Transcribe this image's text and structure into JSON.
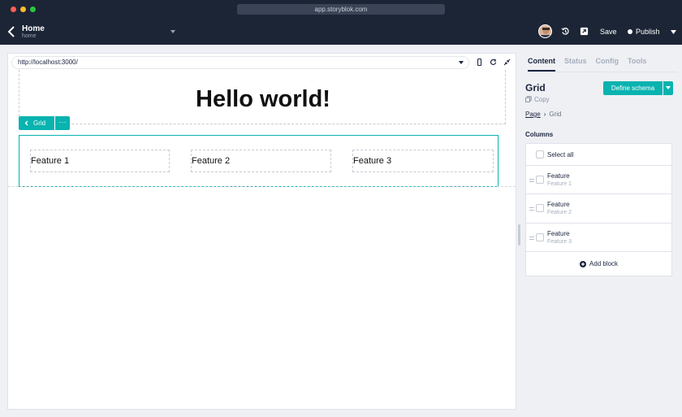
{
  "browser": {
    "url": "app.storyblok.com"
  },
  "header": {
    "title": "Home",
    "subtitle": "home",
    "save_label": "Save",
    "publish_label": "Publish"
  },
  "preview": {
    "url": "http://localhost:3000/",
    "heading": "Hello world!",
    "grid_tag": "Grid",
    "more_label": "···",
    "features": [
      "Feature 1",
      "Feature 2",
      "Feature 3"
    ]
  },
  "panel": {
    "tabs": [
      "Content",
      "Status",
      "Config",
      "Tools"
    ],
    "active_tab": "Content",
    "block_title": "Grid",
    "copy_label": "Copy",
    "define_schema_label": "Define schema",
    "breadcrumb": {
      "root": "Page",
      "current": "Grid"
    },
    "columns_label": "Columns",
    "select_all_label": "Select all",
    "items": [
      {
        "title": "Feature",
        "subtitle": "Feature 1"
      },
      {
        "title": "Feature",
        "subtitle": "Feature 2"
      },
      {
        "title": "Feature",
        "subtitle": "Feature 3"
      }
    ],
    "add_block_label": "Add block"
  },
  "colors": {
    "accent": "#09b3af",
    "chrome": "#1c2535",
    "text": "#1b243f"
  }
}
